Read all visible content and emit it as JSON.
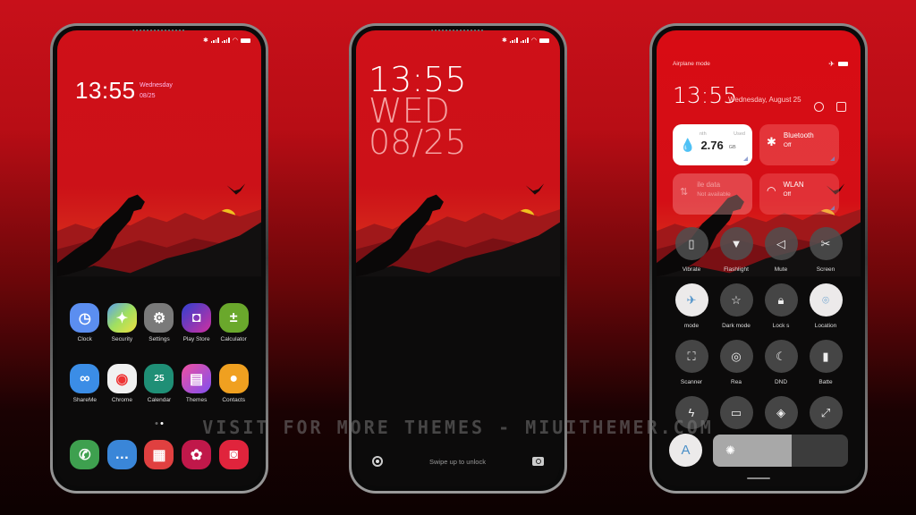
{
  "home_screen": {
    "clock": "13:55",
    "day": "Wednesday",
    "date": "08/25",
    "apps": [
      {
        "label": "Clock",
        "icon": "clock-icon",
        "color": "#5b8ef0"
      },
      {
        "label": "Security",
        "icon": "security-icon",
        "color": "#7bc0a0"
      },
      {
        "label": "Settings",
        "icon": "gear-icon",
        "color": "#7a7a7a"
      },
      {
        "label": "Play Store",
        "icon": "shopping-bag-icon",
        "color": "#9a3fd0"
      },
      {
        "label": "Calculator",
        "icon": "calculator-icon",
        "color": "#6aa82c"
      },
      {
        "label": "ShareMe",
        "icon": "infinity-icon",
        "color": "#3b8de6"
      },
      {
        "label": "Chrome",
        "icon": "chrome-icon",
        "color": "#f1f1f1"
      },
      {
        "label": "Calendar",
        "icon": "calendar-icon",
        "color": "#1f8f76"
      },
      {
        "label": "Themes",
        "icon": "brush-icon",
        "color": "#c04fd0"
      },
      {
        "label": "Contacts",
        "icon": "contact-icon",
        "color": "#f0a020"
      }
    ],
    "calendar_day": "25",
    "dock": [
      {
        "name": "phone",
        "icon": "phone-icon",
        "color": "#3ea04f"
      },
      {
        "name": "messages",
        "icon": "message-icon",
        "color": "#3a86d8"
      },
      {
        "name": "notes",
        "icon": "notes-icon",
        "color": "#e04040"
      },
      {
        "name": "gallery",
        "icon": "flower-icon",
        "color": "#c0184a"
      },
      {
        "name": "camera",
        "icon": "camera-icon",
        "color": "#e0243c"
      }
    ]
  },
  "lock_screen": {
    "clock": "13:55",
    "day": "WED",
    "date": "08/25",
    "unlock_hint": "Swipe up to unlock"
  },
  "control_center": {
    "status_label": "Airplane mode",
    "clock": "13:55",
    "date": "Wednesday, August 25",
    "data_tile": {
      "label_left": "nth",
      "label_right": "Used",
      "value": "2.76",
      "unit": "GB"
    },
    "bluetooth_tile": {
      "title": "Bluetooth",
      "status": "Off"
    },
    "mobile_data_tile": {
      "title": "ile data",
      "status": "Not available"
    },
    "wlan_tile": {
      "title": "WLAN",
      "status": "Off"
    },
    "toggles": [
      {
        "label": "Vibrate",
        "icon": "vibrate-icon",
        "on": false
      },
      {
        "label": "Flashlight",
        "icon": "flashlight-icon",
        "on": false
      },
      {
        "label": "Mute",
        "icon": "mute-icon",
        "on": false
      },
      {
        "label": "Screen",
        "icon": "scissors-icon",
        "on": false
      },
      {
        "label": "mode",
        "icon": "airplane-icon",
        "on": true
      },
      {
        "label": "Dark mode",
        "icon": "star-icon",
        "on": false
      },
      {
        "label": "Lock s",
        "icon": "lock-icon",
        "on": false
      },
      {
        "label": "Location",
        "icon": "location-icon",
        "on": true
      },
      {
        "label": "Scanner",
        "icon": "scanner-icon",
        "on": false
      },
      {
        "label": "Rea",
        "icon": "reading-mode-icon",
        "on": false
      },
      {
        "label": "DND",
        "icon": "moon-icon",
        "on": false
      },
      {
        "label": "Batte",
        "icon": "battery-saver-icon",
        "on": false
      },
      {
        "label": "",
        "icon": "lightning-icon",
        "on": false
      },
      {
        "label": "",
        "icon": "cast-icon",
        "on": false
      },
      {
        "label": "",
        "icon": "nearby-share-icon",
        "on": false
      },
      {
        "label": "",
        "icon": "screen-expand-icon",
        "on": false
      }
    ],
    "auto_brightness_label": "A",
    "brightness_percent": 58
  },
  "watermark": "VISIT FOR MORE THEMES - MIUITHEMER.COM"
}
